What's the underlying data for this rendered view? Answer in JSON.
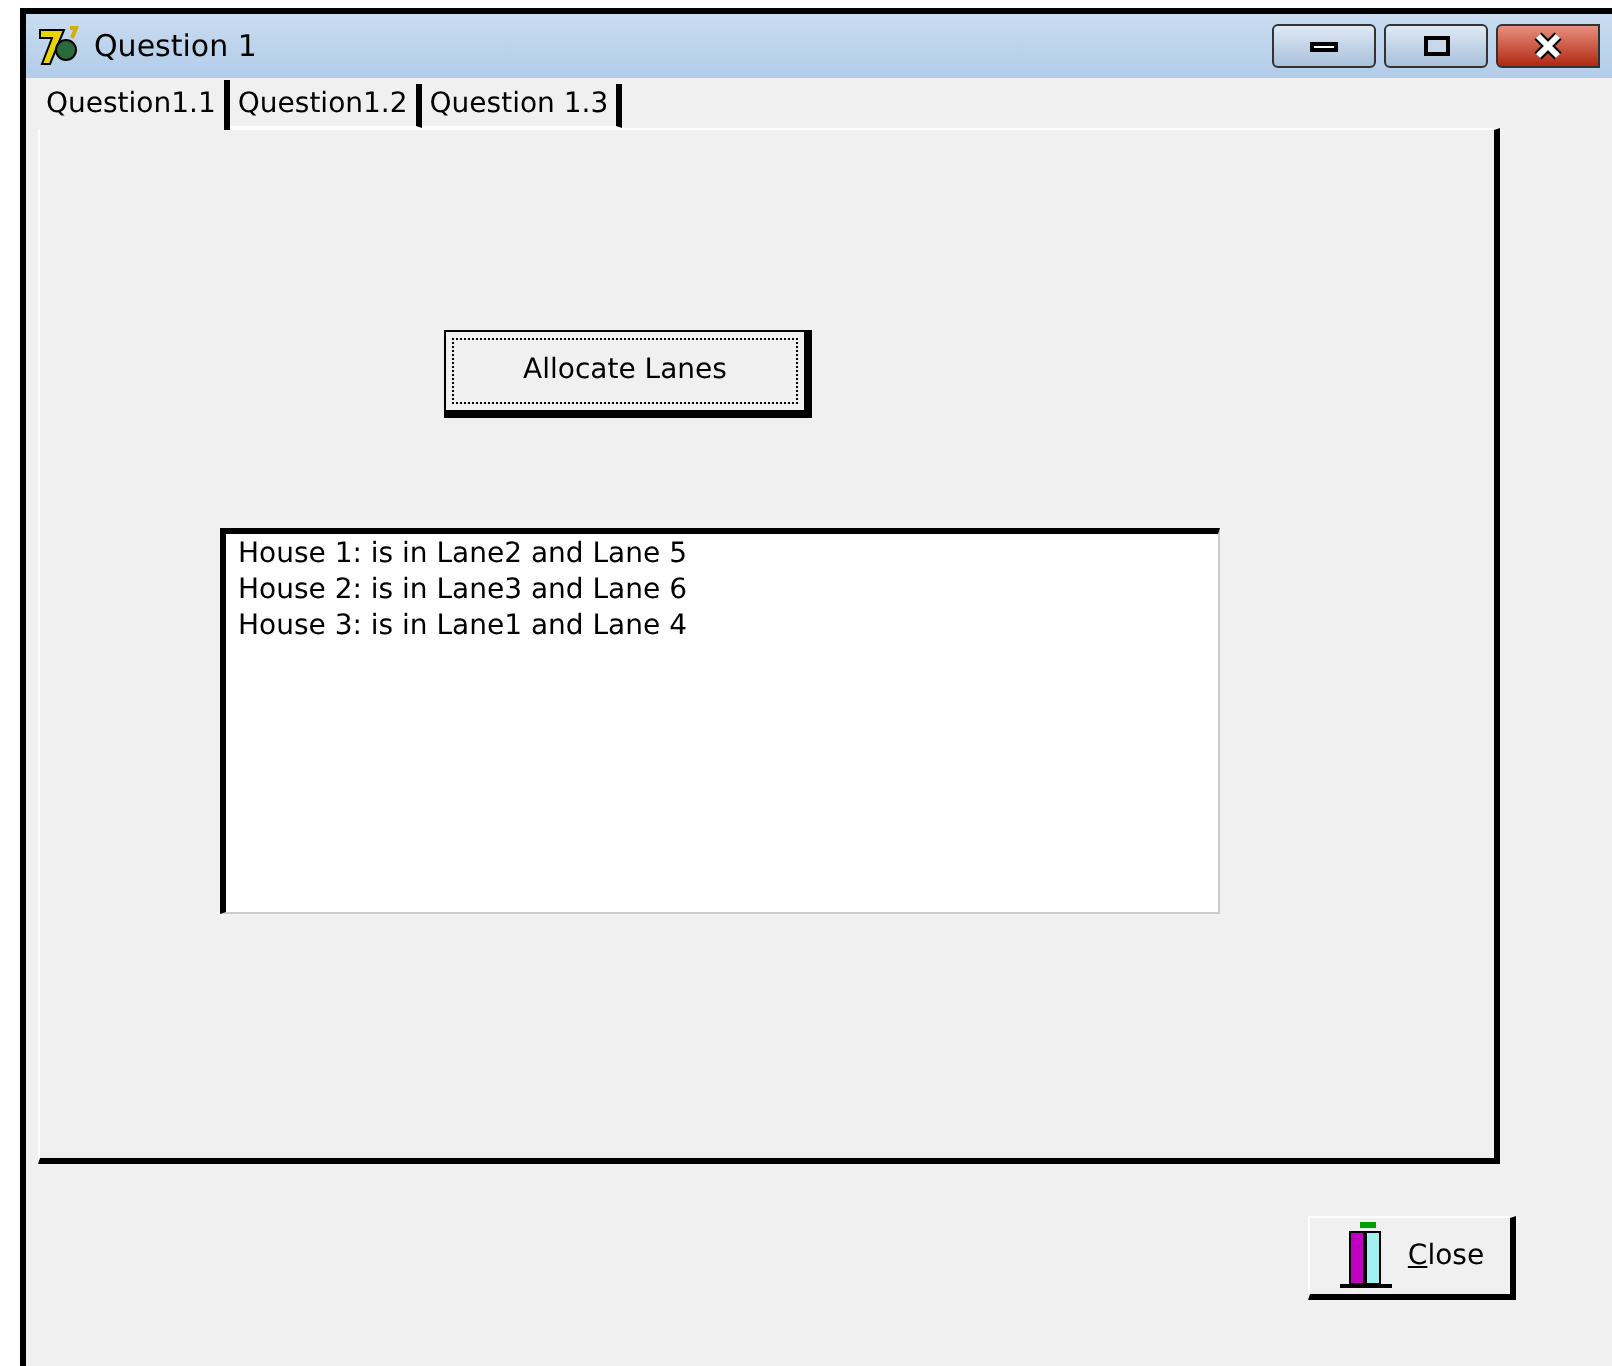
{
  "window": {
    "title": "Question 1"
  },
  "tabs": [
    {
      "label": "Question1.1",
      "selected": true
    },
    {
      "label": "Question1.2",
      "selected": false
    },
    {
      "label": "Question 1.3",
      "selected": false
    }
  ],
  "allocate_button": {
    "label": "Allocate Lanes"
  },
  "output_list": {
    "lines": [
      "House 1: is in Lane2 and Lane 5",
      "House 2: is in Lane3 and Lane 6",
      "House 3: is in Lane1 and Lane 4"
    ]
  },
  "close_button": {
    "label": "Close"
  }
}
